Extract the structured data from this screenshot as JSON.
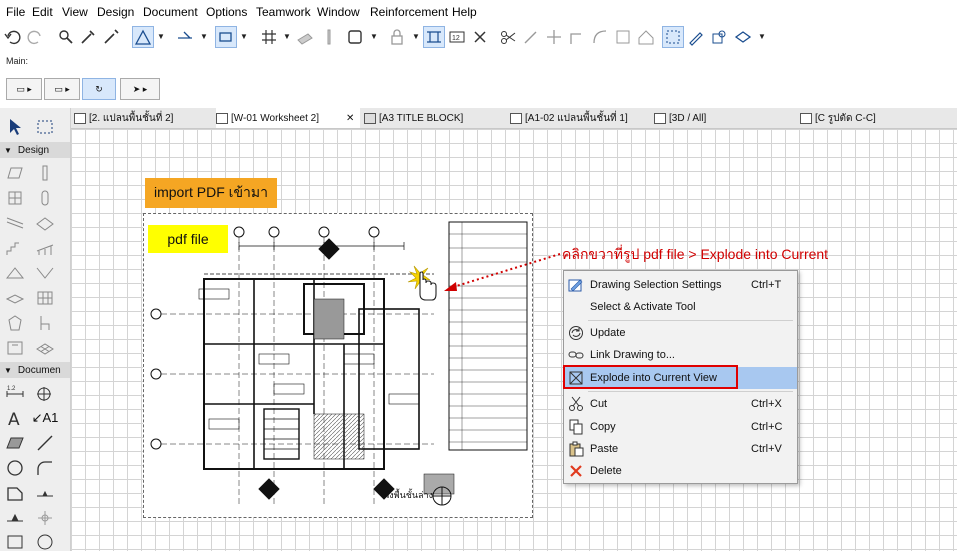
{
  "menubar": [
    "File",
    "Edit",
    "View",
    "Design",
    "Document",
    "Options",
    "Teamwork",
    "Window",
    "Reinforcement",
    "Help"
  ],
  "toolbar": {
    "main_label": "Main:"
  },
  "tabs": [
    {
      "label": "[2. แปลนพื้นชั้นที่ 2]",
      "active": false
    },
    {
      "label": "[W-01 Worksheet 2]",
      "active": true,
      "close": "✕"
    },
    {
      "label": "[A3 TITLE BLOCK]",
      "active": false
    },
    {
      "label": "[A1-02 แปลนพื้นชั้นที่ 1]",
      "active": false
    },
    {
      "label": "[3D / All]",
      "active": false
    },
    {
      "label": "[C รูปตัด C-C]",
      "active": false
    }
  ],
  "toolbox": {
    "design_section": "Design",
    "document_section": "Documen",
    "label_tool": "A1"
  },
  "canvas": {
    "import_label": "import PDF เข้ามา",
    "pdf_label": "pdf file",
    "annotation": "คลิกขวาที่รูป pdf file > Explode into Current",
    "drawing_caption": "ผังพื้นชั้นล่าง",
    "cursor_icon": "hand-cursor-icon"
  },
  "context_menu": {
    "items": [
      {
        "label": "Drawing Selection Settings",
        "shortcut": "Ctrl+T",
        "icon": "drawing-settings-icon"
      },
      {
        "label": "Select & Activate Tool",
        "shortcut": "",
        "icon": ""
      },
      {
        "label": "Update",
        "shortcut": "",
        "icon": "update-icon"
      },
      {
        "label": "Link Drawing to...",
        "shortcut": "",
        "icon": "link-icon"
      },
      {
        "label": "Explode into Current View",
        "shortcut": "",
        "icon": "explode-icon",
        "highlighted": true
      },
      {
        "label": "Cut",
        "shortcut": "Ctrl+X",
        "icon": "scissors-icon"
      },
      {
        "label": "Copy",
        "shortcut": "Ctrl+C",
        "icon": "copy-icon"
      },
      {
        "label": "Paste",
        "shortcut": "Ctrl+V",
        "icon": "paste-icon"
      },
      {
        "label": "Delete",
        "shortcut": "",
        "icon": "delete-icon"
      }
    ]
  },
  "colors": {
    "accent_orange": "#f5a623",
    "pdf_yellow": "#ffff00",
    "annotation_red": "#d00000",
    "highlight_blue": "#a8c8f0"
  }
}
